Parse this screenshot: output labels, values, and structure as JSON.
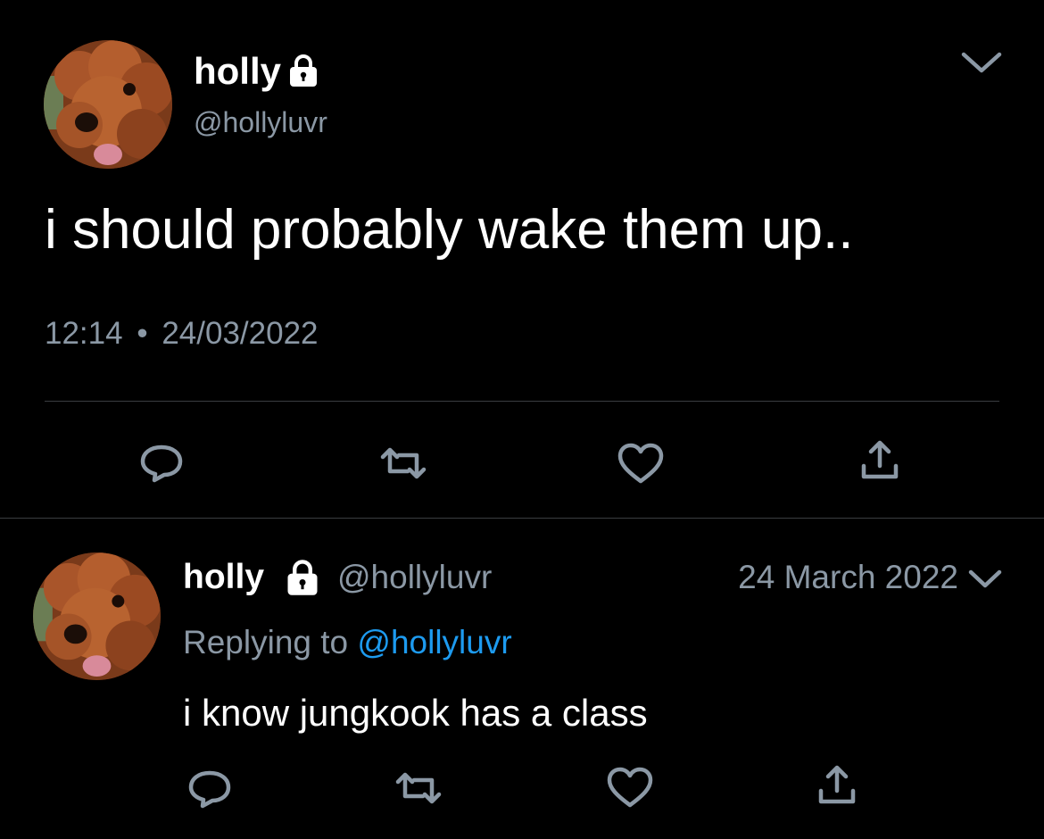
{
  "main_tweet": {
    "display_name": "holly",
    "handle": "@hollyluvr",
    "text": "i should probably wake them up..",
    "time": "12:14",
    "separator": "•",
    "date": "24/03/2022",
    "avatar_icon": "poodle-avatar",
    "lock_icon": "lock-icon",
    "menu_icon": "chevron-down-icon"
  },
  "actions": {
    "reply_icon": "reply-icon",
    "retweet_icon": "retweet-icon",
    "like_icon": "heart-icon",
    "share_icon": "share-icon"
  },
  "reply_tweet": {
    "display_name": "holly",
    "handle": "@hollyluvr",
    "date": "24 March 2022",
    "replying_prefix": "Replying to",
    "replying_handle": "@hollyluvr",
    "text": "i know jungkook has a class"
  },
  "colors": {
    "background": "#000000",
    "text": "#ffffff",
    "muted": "#8b98a5",
    "link": "#1d9bf0",
    "divider": "#3a3d41"
  }
}
